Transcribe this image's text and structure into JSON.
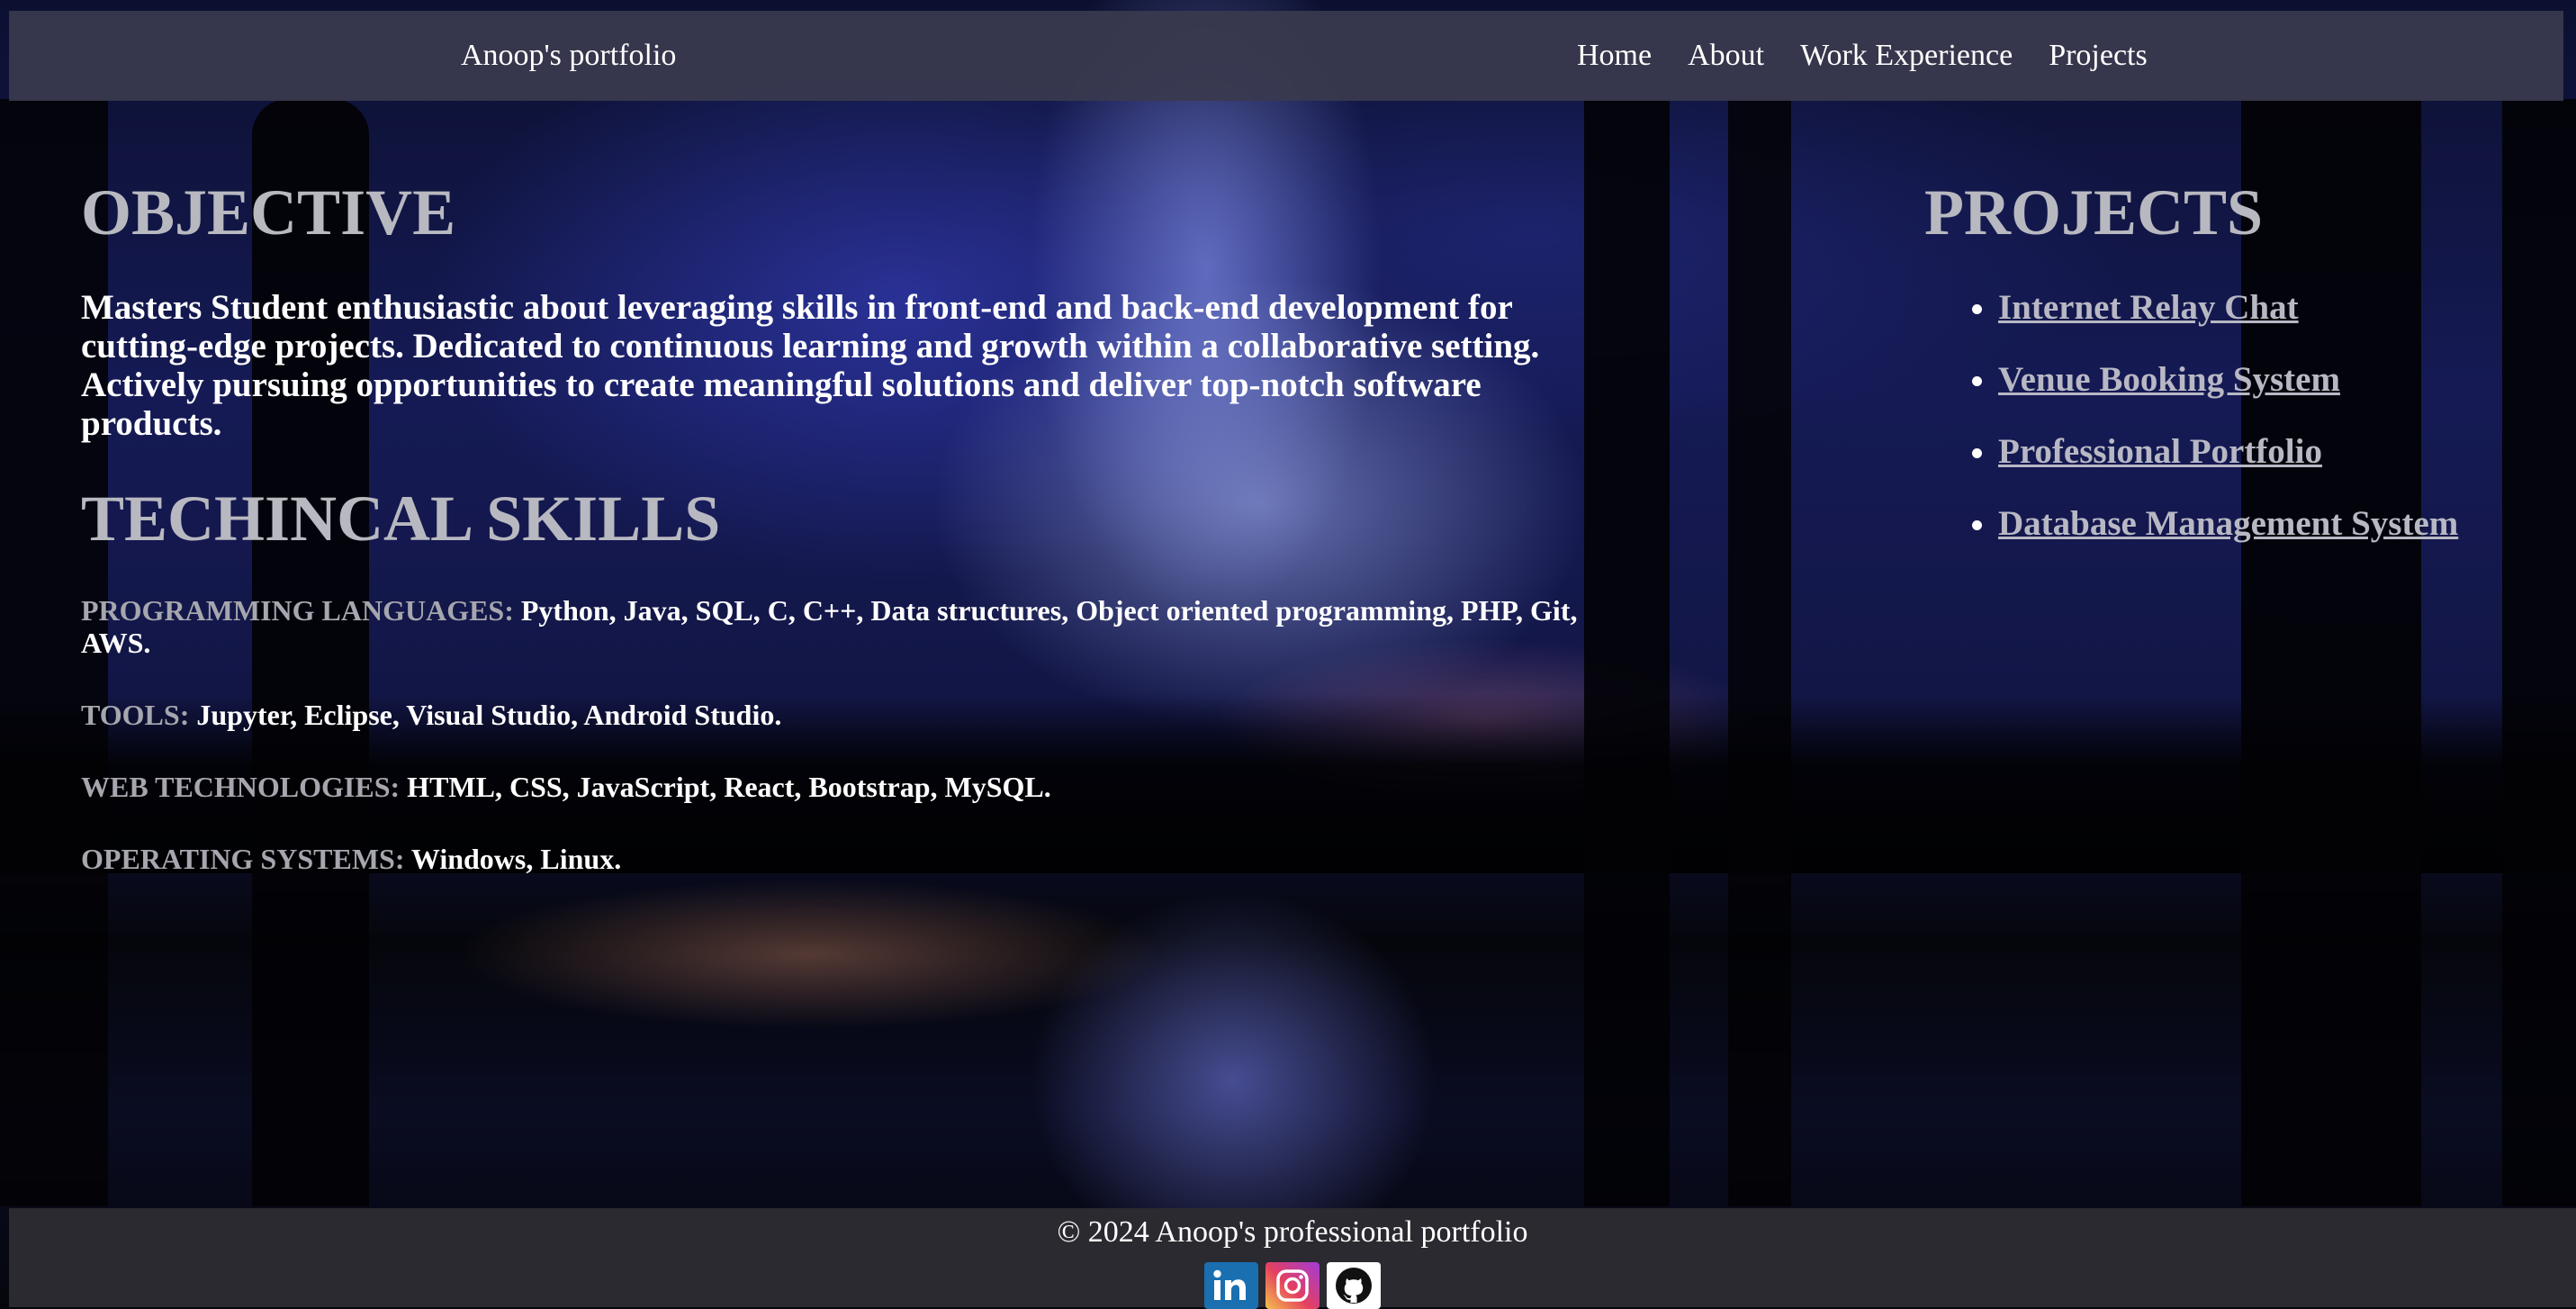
{
  "header": {
    "brand": "Anoop's portfolio",
    "nav": [
      "Home",
      "About",
      "Work Experience",
      "Projects"
    ]
  },
  "objective": {
    "heading": "OBJECTIVE",
    "text": "Masters Student enthusiastic about leveraging skills in front-end and back-end development for cutting-edge projects. Dedicated to continuous learning and growth within a collaborative setting. Actively pursuing opportunities to create meaningful solutions and deliver top-notch software products."
  },
  "skills": {
    "heading": "TECHINCAL SKILLS",
    "items": [
      {
        "label": "PROGRAMMING LANGUAGES:",
        "value": "Python, Java, SQL, C, C++, Data structures, Object oriented programming, PHP, Git, AWS."
      },
      {
        "label": "TOOLS:",
        "value": "Jupyter, Eclipse, Visual Studio, Android Studio."
      },
      {
        "label": "WEB TECHNOLOGIES:",
        "value": "HTML, CSS, JavaScript, React, Bootstrap, MySQL."
      },
      {
        "label": "OPERATING SYSTEMS:",
        "value": "Windows, Linux."
      }
    ]
  },
  "projects": {
    "heading": "PROJECTS",
    "items": [
      "Internet Relay Chat",
      "Venue Booking System",
      "Professional Portfolio",
      "Database Management System"
    ]
  },
  "footer": {
    "copyright": "© 2024 Anoop's professional portfolio",
    "socials": [
      "linkedin-icon",
      "instagram-icon",
      "github-icon"
    ]
  },
  "colors": {
    "header_bg": "#3a3a4e",
    "footer_bg": "#2a2a30",
    "heading_gray": "#b8b8c0",
    "label_gray": "#a6a6ae",
    "linkedin": "#1a6fb0",
    "github_bg": "#ffffff"
  }
}
